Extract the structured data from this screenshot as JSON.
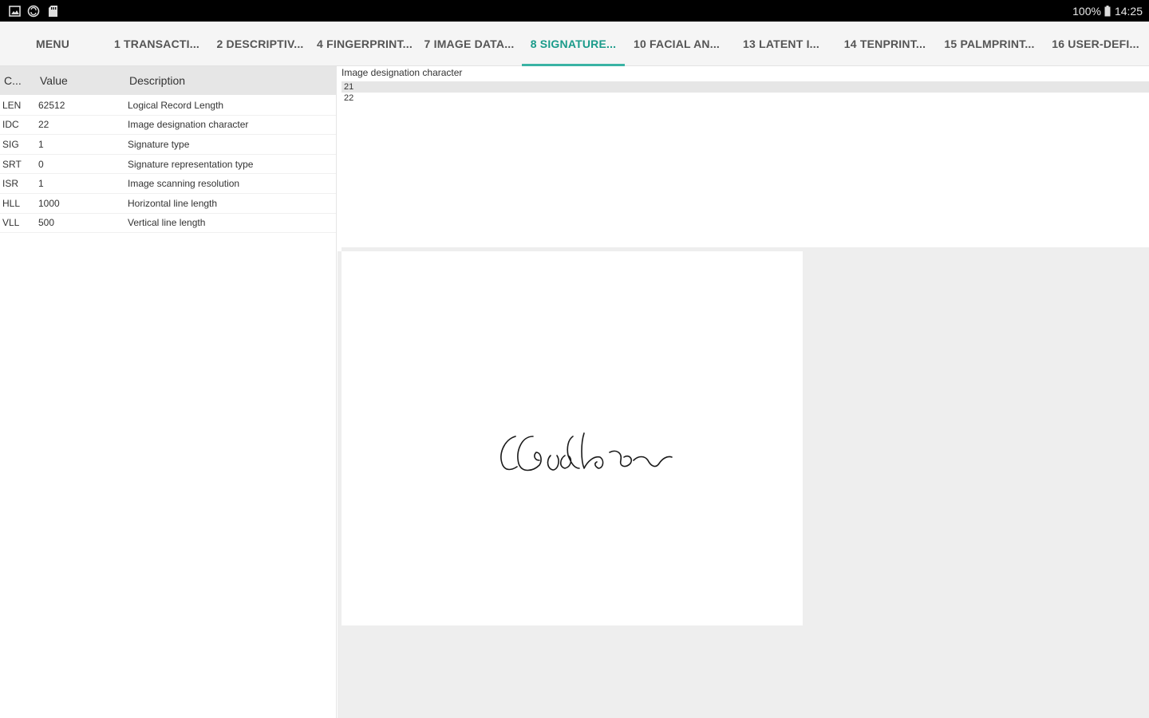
{
  "status_bar": {
    "left_icons": [
      "image-icon",
      "sync-icon",
      "sd-card-icon"
    ],
    "battery_text": "100%",
    "time": "14:25"
  },
  "tabs": [
    {
      "label": "MENU",
      "active": false
    },
    {
      "label": "1 TRANSACTI...",
      "active": false
    },
    {
      "label": "2 DESCRIPTIV...",
      "active": false
    },
    {
      "label": "4 FINGERPRINT...",
      "active": false
    },
    {
      "label": "7 IMAGE DATA...",
      "active": false
    },
    {
      "label": "8 SIGNATURE...",
      "active": true
    },
    {
      "label": "10 FACIAL AN...",
      "active": false
    },
    {
      "label": "13 LATENT I...",
      "active": false
    },
    {
      "label": "14 TENPRINT...",
      "active": false
    },
    {
      "label": "15 PALMPRINT...",
      "active": false
    },
    {
      "label": "16 USER-DEFI...",
      "active": false
    }
  ],
  "table": {
    "headers": {
      "code": "C...",
      "value": "Value",
      "description": "Description"
    },
    "rows": [
      {
        "code": "LEN",
        "value": "62512",
        "description": "Logical Record Length"
      },
      {
        "code": "IDC",
        "value": "22",
        "description": "Image designation character"
      },
      {
        "code": "SIG",
        "value": "1",
        "description": "Signature type"
      },
      {
        "code": "SRT",
        "value": "0",
        "description": "Signature representation type"
      },
      {
        "code": "ISR",
        "value": "1",
        "description": "Image scanning resolution"
      },
      {
        "code": "HLL",
        "value": "1000",
        "description": "Horizontal line length"
      },
      {
        "code": "VLL",
        "value": "500",
        "description": "Vertical line length"
      }
    ]
  },
  "detail": {
    "label": "Image designation character",
    "options": [
      "21",
      "22"
    ],
    "selected_index": 0
  },
  "colors": {
    "accent": "#1a9b8a",
    "status_bar": "#000000",
    "header_bg": "#e6e6e6",
    "panel_bg": "#eeeeee"
  }
}
